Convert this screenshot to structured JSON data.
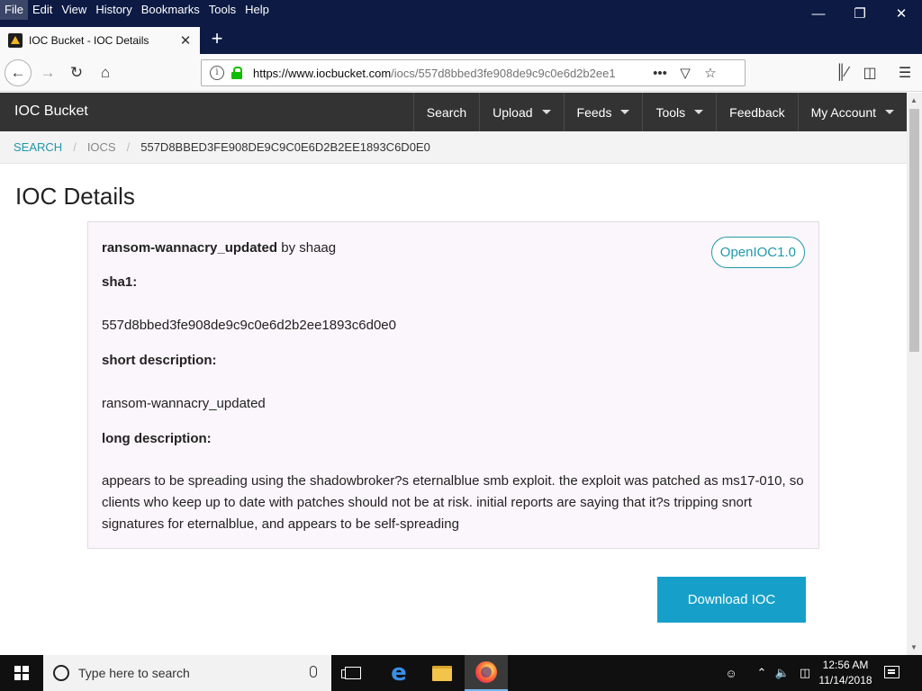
{
  "browser": {
    "menu": [
      "File",
      "Edit",
      "View",
      "History",
      "Bookmarks",
      "Tools",
      "Help"
    ],
    "tab_title": "IOC Bucket - IOC Details",
    "url_host": "https://www.iocbucket.com",
    "url_path": "/iocs/557d8bbed3fe908de9c9c0e6d2b2ee1"
  },
  "site": {
    "brand": "IOC Bucket",
    "nav": [
      "Search",
      "Upload",
      "Feeds",
      "Tools",
      "Feedback",
      "My Account"
    ],
    "breadcrumb": {
      "search": "SEARCH",
      "iocs": "IOCS",
      "current": "557D8BBED3FE908DE9C9C0E6D2B2EE1893C6D0E0"
    }
  },
  "page": {
    "title": "IOC Details",
    "ioc_name": "ransom-wannacry_updated",
    "by_label": "by",
    "author": "shaag",
    "format_badge": "OpenIOC1.0",
    "sha1_label": "sha1:",
    "sha1_value": "557d8bbed3fe908de9c9c0e6d2b2ee1893c6d0e0",
    "short_label": "short description:",
    "short_value": "ransom-wannacry_updated",
    "long_label": "long description:",
    "long_value": "appears to be spreading using the shadowbroker?s eternalblue smb exploit. the exploit was patched as ms17-010, so clients who keep up to date with patches should not be at risk. initial reports are saying that it?s tripping snort signatures for eternalblue, and appears to be self-spreading",
    "download_label": "Download IOC"
  },
  "taskbar": {
    "search_placeholder": "Type here to search",
    "time": "12:56 AM",
    "date": "11/14/2018"
  },
  "colors": {
    "accent": "#2199a8",
    "download_button": "#16a0c9",
    "site_nav": "#333333",
    "browser_frame": "#0c1a44"
  }
}
